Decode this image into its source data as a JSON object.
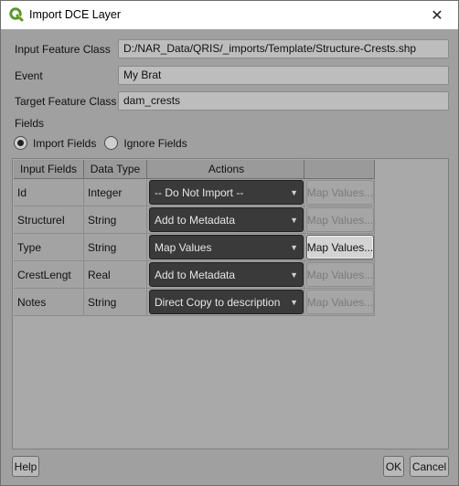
{
  "window": {
    "title": "Import DCE Layer",
    "close_glyph": "✕"
  },
  "form": {
    "input_feature_class": {
      "label": "Input Feature Class",
      "value": "D:/NAR_Data/QRIS/_imports/Template/Structure-Crests.shp"
    },
    "event": {
      "label": "Event",
      "value": "My  Brat"
    },
    "target_feature_class": {
      "label": "Target Feature Class",
      "value": "dam_crests"
    },
    "fields_label": "Fields"
  },
  "radios": {
    "import_fields": {
      "label": "Import Fields",
      "checked": true
    },
    "ignore_fields": {
      "label": "Ignore Fields",
      "checked": false
    }
  },
  "table": {
    "headers": [
      "Input Fields",
      "Data Type",
      "Actions",
      ""
    ],
    "rows": [
      {
        "field": "Id",
        "type": "Integer",
        "action": "-- Do Not Import --",
        "map_label": "Map Values...",
        "map_enabled": false
      },
      {
        "field": "StructureI",
        "type": "String",
        "action": "Add to Metadata",
        "map_label": "Map Values...",
        "map_enabled": false
      },
      {
        "field": "Type",
        "type": "String",
        "action": "Map Values",
        "map_label": "Map Values...",
        "map_enabled": true
      },
      {
        "field": "CrestLengt",
        "type": "Real",
        "action": "Add to Metadata",
        "map_label": "Map Values...",
        "map_enabled": false
      },
      {
        "field": "Notes",
        "type": "String",
        "action": "Direct Copy to description",
        "map_label": "Map Values...",
        "map_enabled": false
      }
    ]
  },
  "buttons": {
    "help": "Help",
    "ok": "OK",
    "cancel": "Cancel"
  },
  "icons": {
    "app": "qgis-logo-icon",
    "combo_arrow": "chevron-down-icon"
  },
  "colors": {
    "qgis_green": "#589632",
    "qgis_yellow": "#ee7913"
  }
}
